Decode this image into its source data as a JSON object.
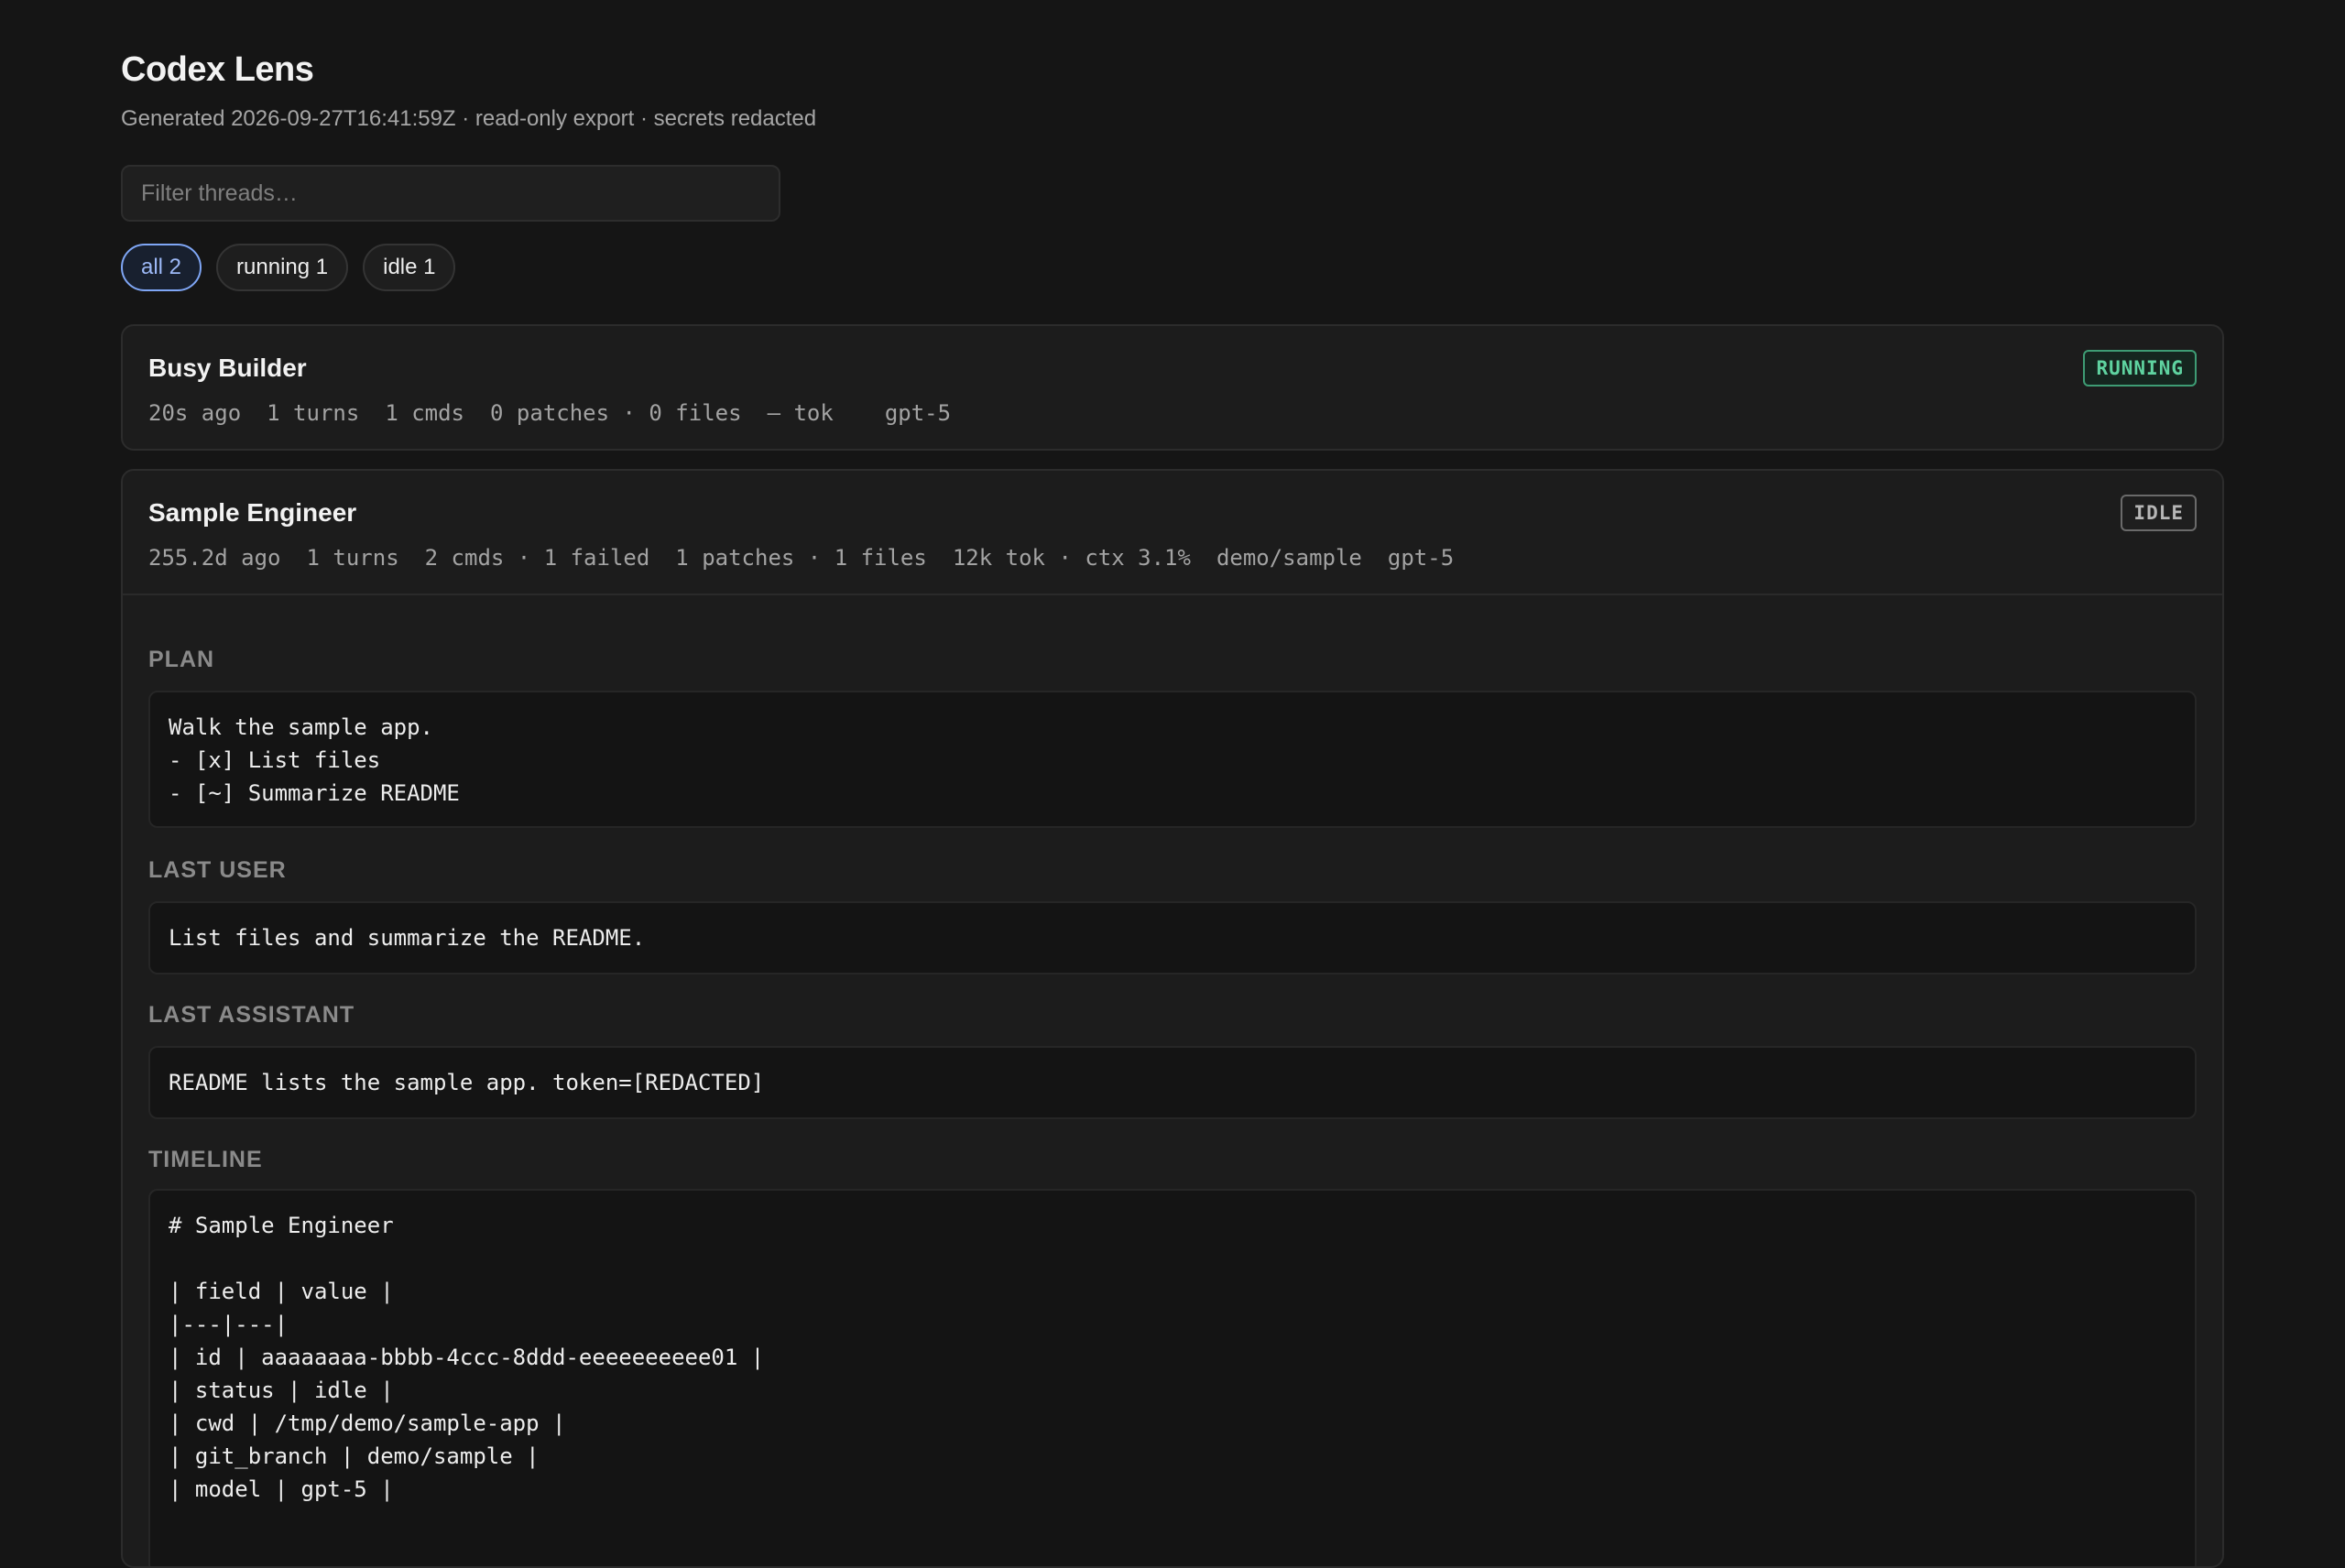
{
  "header": {
    "title": "Codex Lens",
    "subtitle": "Generated 2026-09-27T16:41:59Z · read-only export · secrets redacted"
  },
  "search": {
    "placeholder": "Filter threads…",
    "value": ""
  },
  "filters": [
    {
      "label": "all 2",
      "active": true
    },
    {
      "label": "running 1",
      "active": false
    },
    {
      "label": "idle 1",
      "active": false
    }
  ],
  "threads": [
    {
      "name": "Busy Builder",
      "status": "RUNNING",
      "meta": {
        "age": "20s ago",
        "turns": "1 turns",
        "cmds": "1 cmds",
        "changes": "0 patches · 0 files",
        "tokens": "— tok",
        "branch": "",
        "model": "gpt-5"
      }
    },
    {
      "name": "Sample Engineer",
      "status": "IDLE",
      "meta": {
        "age": "255.2d ago",
        "turns": "1 turns",
        "cmds": "2 cmds · 1 failed",
        "changes": "1 patches · 1 files",
        "tokens": "12k tok · ctx 3.1%",
        "branch": "demo/sample",
        "model": "gpt-5"
      },
      "sections": {
        "plan_label": "PLAN",
        "plan_text": "Walk the sample app.\n- [x] List files\n- [~] Summarize README",
        "last_user_label": "LAST USER",
        "last_user_text": "List files and summarize the README.",
        "last_assistant_label": "LAST ASSISTANT",
        "last_assistant_text": "README lists the sample app. token=[REDACTED]",
        "timeline_label": "TIMELINE",
        "timeline_text": "# Sample Engineer\n\n| field | value |\n|---|---|\n| id | aaaaaaaa-bbbb-4ccc-8ddd-eeeeeeeeee01 |\n| status | idle |\n| cwd | /tmp/demo/sample-app |\n| git_branch | demo/sample |\n| model | gpt-5 |"
      }
    }
  ],
  "colors": {
    "background": "#151515",
    "card": "#1c1c1c",
    "accent": "#7fa6f5",
    "running": "#5fd3a0",
    "idle": "#b6b6b6"
  }
}
